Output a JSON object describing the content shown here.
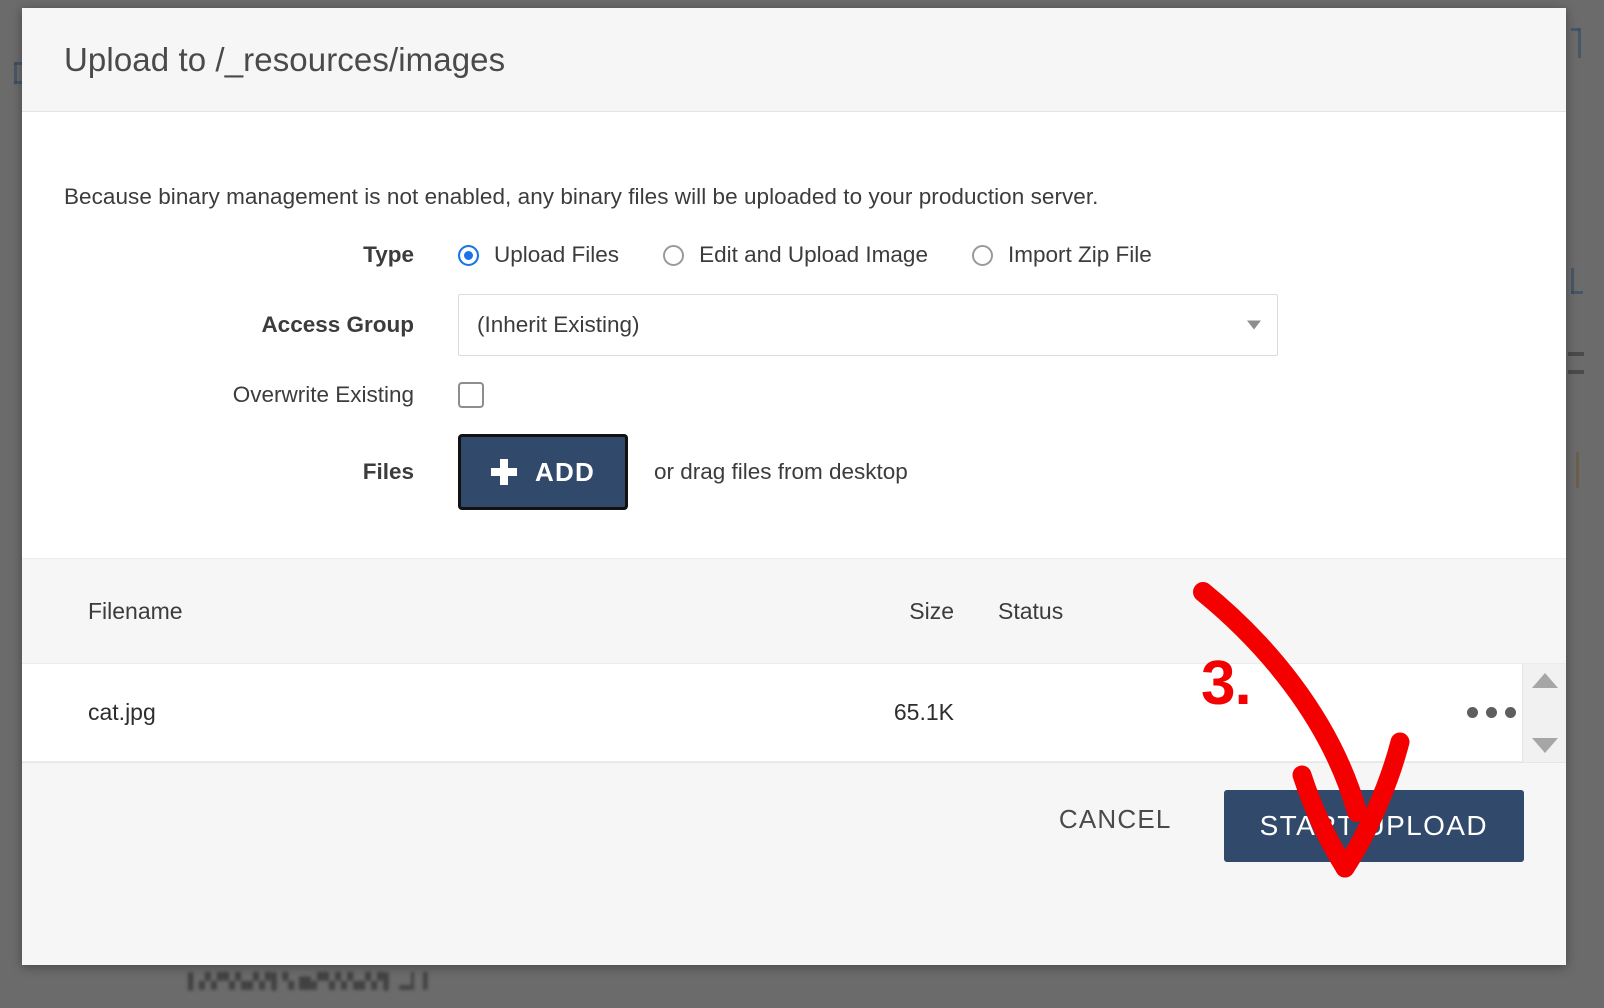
{
  "dialog": {
    "title": "Upload to /_resources/images",
    "notice": "Because binary management is not enabled, any binary files will be uploaded to your production server."
  },
  "form": {
    "type": {
      "label": "Type",
      "options": [
        {
          "label": "Upload Files",
          "selected": true
        },
        {
          "label": "Edit and Upload Image",
          "selected": false
        },
        {
          "label": "Import Zip File",
          "selected": false
        }
      ]
    },
    "access_group": {
      "label": "Access Group",
      "value": "(Inherit Existing)"
    },
    "overwrite_existing": {
      "label": "Overwrite Existing",
      "checked": false
    },
    "files": {
      "label": "Files",
      "add_button": "ADD",
      "add_icon": "plus-icon",
      "drag_hint": "or drag files from desktop"
    }
  },
  "file_table": {
    "columns": [
      "Filename",
      "Size",
      "Status"
    ],
    "rows": [
      {
        "filename": "cat.jpg",
        "size": "65.1K",
        "status": "",
        "menu_icon": "ellipsis-icon"
      }
    ],
    "scrollbar": {
      "up_icon": "scroll-up-arrow-icon",
      "down_icon": "scroll-down-arrow-icon"
    }
  },
  "footer": {
    "cancel_label": "CANCEL",
    "start_upload_label": "START UPLOAD"
  },
  "annotation": {
    "step_number": "3.",
    "color": "#f40000",
    "arrow_icon": "curved-down-arrow-icon"
  },
  "colors": {
    "accent_navy": "#31496a",
    "radio_blue": "#1a73e8",
    "header_bg": "#f6f6f6",
    "annotation_red": "#f40000"
  }
}
